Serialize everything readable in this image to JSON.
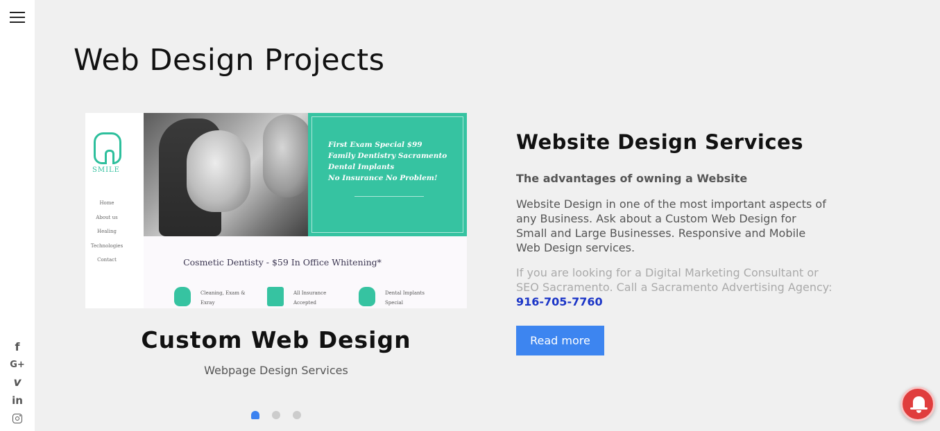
{
  "page": {
    "title": "Web Design Projects"
  },
  "project": {
    "title": "Custom Web Design",
    "subtitle": "Webpage Design Services",
    "preview": {
      "logo_text": "SMILE",
      "nav": [
        "Home",
        "About us",
        "Healing",
        "Technologies",
        "Contact"
      ],
      "promo_lines": [
        "First Exam Special $99",
        "Family Dentistry Sacramento",
        "Dental Implants",
        "No Insurance No Problem!"
      ],
      "cosmetic_line": "Cosmetic Dentisty - $59 In Office Whitening*",
      "services": [
        {
          "line1": "Cleaning, Exam &",
          "line2": "Exray"
        },
        {
          "line1": "All Insurance",
          "line2": "Accepted"
        },
        {
          "line1": "Dental Implants",
          "line2": "Special"
        }
      ]
    }
  },
  "carousel": {
    "total": 3,
    "active_index": 0
  },
  "services": {
    "title": "Website Design Services",
    "advantages": "The advantages of owning a Website",
    "description": "Website Design in one of the most important aspects of any Business. Ask about a Custom Web Design for Small and Large Businesses. Responsive and Mobile Web Design services.",
    "consult_text": "If you are looking for a Digital Marketing Consultant or SEO Sacramento. Call a Sacramento Advertising Agency:",
    "phone": "916-705-7760",
    "read_more_label": "Read more"
  },
  "social": {
    "facebook": "f",
    "google_plus": "G+",
    "vimeo": "v",
    "linkedin": "in"
  },
  "colors": {
    "accent": "#3d85f0",
    "phone_link": "#1b35c7",
    "bell": "#e03d3d",
    "teal": "#36c3a1"
  }
}
